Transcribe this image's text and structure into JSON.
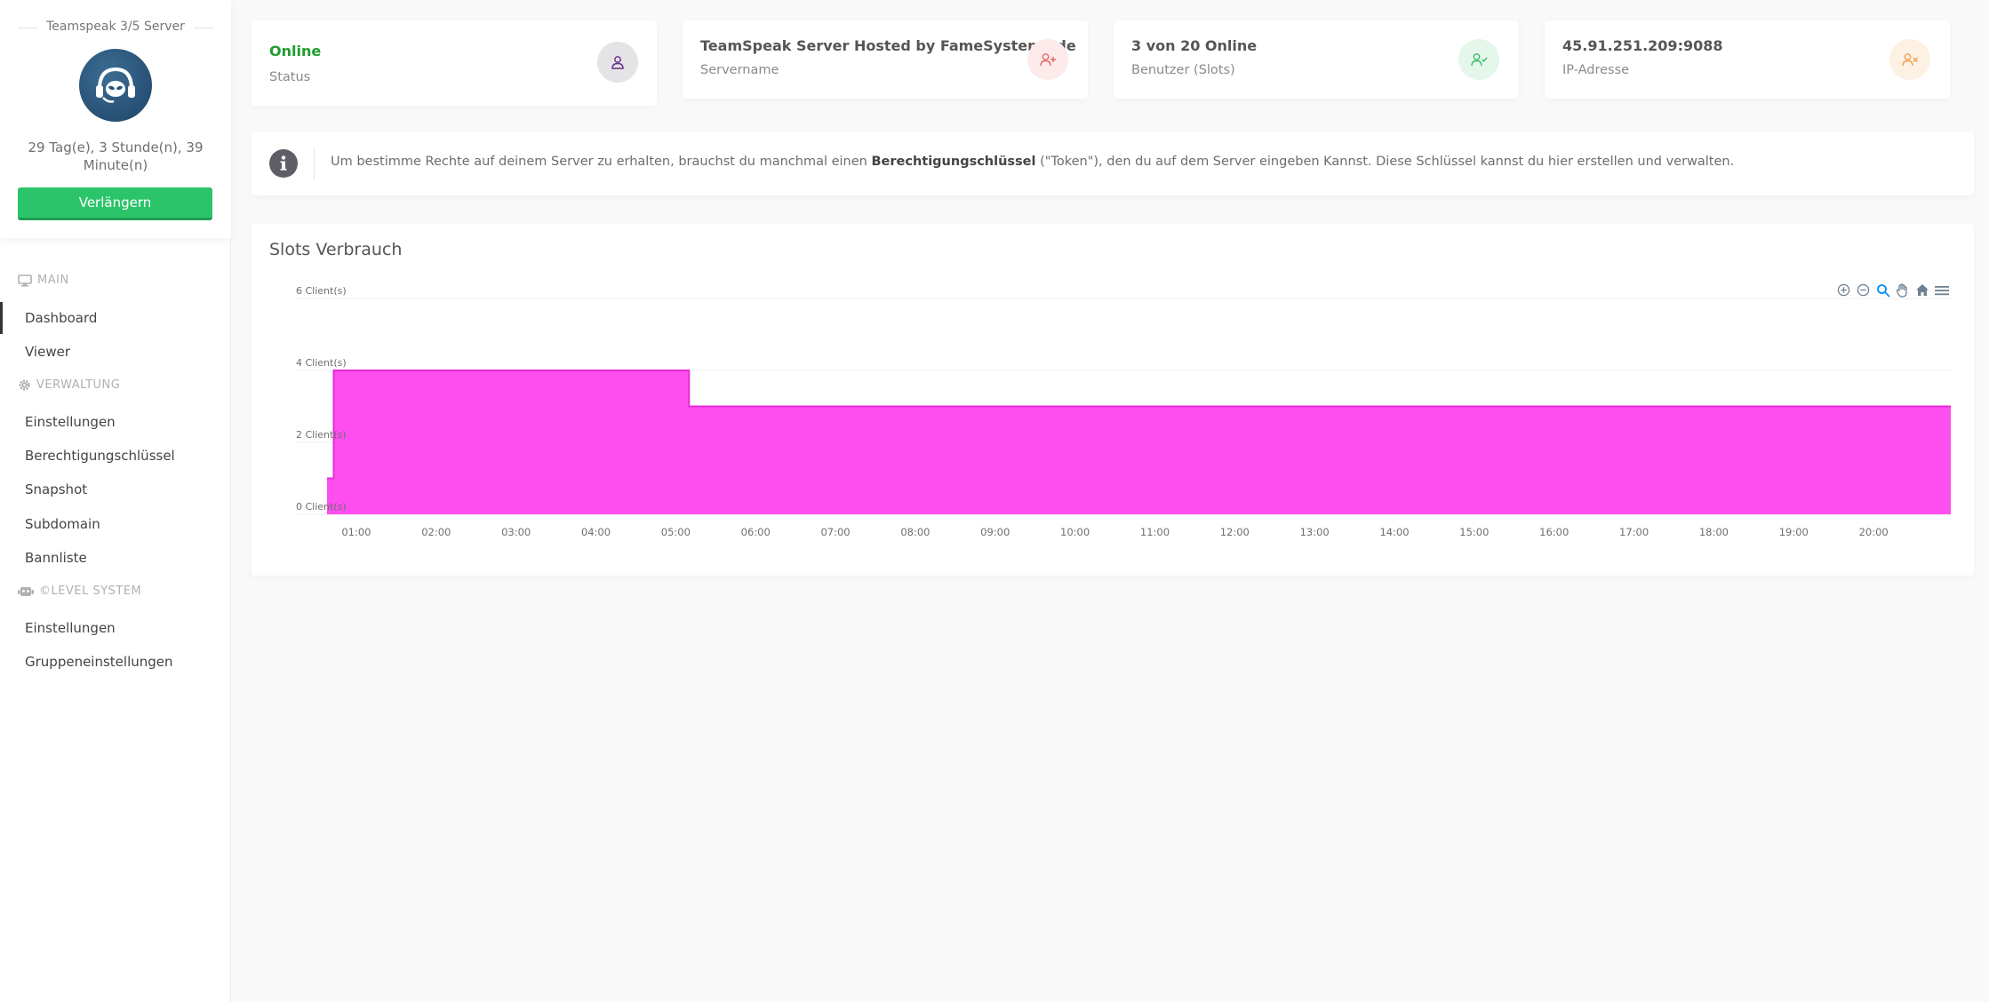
{
  "sidebar": {
    "server_title": "Teamspeak 3/5 Server",
    "uptime": "29 Tag(e), 3 Stunde(n), 39 Minute(n)",
    "renew_label": "Verlängern",
    "sections": {
      "main": "MAIN",
      "verwaltung": "VERWALTUNG",
      "level": "©LEVEL SYSTEM"
    },
    "items": {
      "dashboard": "Dashboard",
      "viewer": "Viewer",
      "einstellungen": "Einstellungen",
      "berechtigung": "Berechtigungschlüssel",
      "snapshot": "Snapshot",
      "subdomain": "Subdomain",
      "bannliste": "Bannliste",
      "level_einstellungen": "Einstellungen",
      "gruppen": "Gruppeneinstellungen"
    }
  },
  "stats": {
    "status": {
      "value": "Online",
      "label": "Status",
      "value_color": "#1f9d2f",
      "icon": "user-icon",
      "icon_bg": "#e4e4e6",
      "icon_color": "#6a2c8a"
    },
    "servername": {
      "value": "TeamSpeak Server Hosted by FameSystems.de",
      "label": "Servername",
      "icon": "user-plus-icon",
      "icon_bg": "#fdeaea",
      "icon_color": "#e06a6a"
    },
    "slots": {
      "value": "3 von 20 Online",
      "label": "Benutzer (Slots)",
      "icon": "user-check-icon",
      "icon_bg": "#e4f7ea",
      "icon_color": "#3cbf6a"
    },
    "ip": {
      "value": "45.91.251.209:9088",
      "label": "IP-Adresse",
      "icon": "user-x-icon",
      "icon_bg": "#fdf1e4",
      "icon_color": "#f0a050"
    }
  },
  "info": {
    "before": "Um bestimme Rechte auf deinem Server zu erhalten, brauchst du manchmal einen ",
    "bold": "Berechtigungschlüssel",
    "after": " (\"Token\"), den du auf dem Server eingeben Kannst. Diese Schlüssel kannst du hier erstellen und verwalten."
  },
  "chart_title": "Slots Verbrauch",
  "chart_data": {
    "type": "area",
    "ylabel": "",
    "xlabel": "",
    "ylim": [
      0,
      6
    ],
    "y_ticks": [
      {
        "value": 0,
        "label": "0 Client(s)"
      },
      {
        "value": 2,
        "label": "2 Client(s)"
      },
      {
        "value": 4,
        "label": "4 Client(s)"
      },
      {
        "value": 6,
        "label": "6 Client(s)"
      }
    ],
    "xlim": [
      "00:38",
      "20:58"
    ],
    "x_ticks": [
      "01:00",
      "02:00",
      "03:00",
      "04:00",
      "05:00",
      "06:00",
      "07:00",
      "08:00",
      "09:00",
      "10:00",
      "11:00",
      "12:00",
      "13:00",
      "14:00",
      "15:00",
      "16:00",
      "17:00",
      "18:00",
      "19:00",
      "20:00"
    ],
    "color": "#ff44ee",
    "series": [
      {
        "x": [
          "00:38",
          "00:43",
          "00:43",
          "05:10",
          "05:10",
          "20:58"
        ],
        "y": [
          1,
          1,
          4,
          4,
          3,
          3
        ]
      }
    ],
    "grid": true
  }
}
